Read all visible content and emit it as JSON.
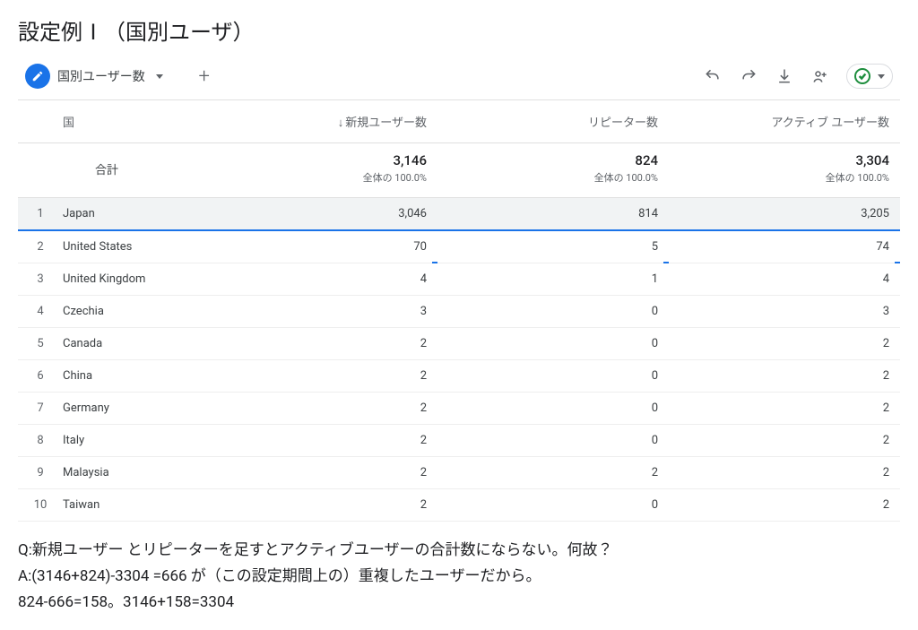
{
  "page_title": "設定例Ⅰ（国別ユーザ）",
  "dimension_chip": "国別ユーザー数",
  "table": {
    "headers": {
      "country": "国",
      "col1": "新規ユーザー数",
      "col2": "リピーター数",
      "col3": "アクティブ ユーザー数"
    },
    "totals": {
      "label": "合計",
      "pct_label": "全体の 100.0%",
      "col1": "3,146",
      "col2": "824",
      "col3": "3,304"
    },
    "rows": [
      {
        "rank": "1",
        "country": "Japan",
        "c1": "3,046",
        "c2": "814",
        "c3": "3,205"
      },
      {
        "rank": "2",
        "country": "United States",
        "c1": "70",
        "c2": "5",
        "c3": "74"
      },
      {
        "rank": "3",
        "country": "United Kingdom",
        "c1": "4",
        "c2": "1",
        "c3": "4"
      },
      {
        "rank": "4",
        "country": "Czechia",
        "c1": "3",
        "c2": "0",
        "c3": "3"
      },
      {
        "rank": "5",
        "country": "Canada",
        "c1": "2",
        "c2": "0",
        "c3": "2"
      },
      {
        "rank": "6",
        "country": "China",
        "c1": "2",
        "c2": "0",
        "c3": "2"
      },
      {
        "rank": "7",
        "country": "Germany",
        "c1": "2",
        "c2": "0",
        "c3": "2"
      },
      {
        "rank": "8",
        "country": "Italy",
        "c1": "2",
        "c2": "0",
        "c3": "2"
      },
      {
        "rank": "9",
        "country": "Malaysia",
        "c1": "2",
        "c2": "2",
        "c3": "2"
      },
      {
        "rank": "10",
        "country": "Taiwan",
        "c1": "2",
        "c2": "0",
        "c3": "2"
      }
    ]
  },
  "qa": {
    "line1": "Q:新規ユーザー とリピーターを足すとアクティブユーザーの合計数にならない。何故？",
    "line2": "A:(3146+824)-3304 =666 が（この設定期間上の）重複したユーザーだから。",
    "line3": "824-666=158。3146+158=3304"
  }
}
